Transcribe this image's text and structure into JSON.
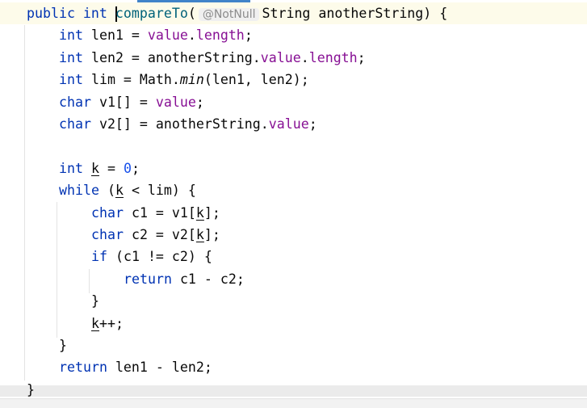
{
  "editor": {
    "language": "java",
    "colors": {
      "keyword": "#0033b3",
      "field": "#871094",
      "number": "#1750eb",
      "method": "#00627a",
      "text": "#080808",
      "accent": "#4083c9"
    },
    "lines": [
      {
        "indent": 0,
        "tokens": [
          {
            "t": "public int ",
            "c": "kw"
          },
          {
            "caret": true
          },
          {
            "t": "compareTo",
            "c": "mth"
          },
          {
            "t": "("
          },
          {
            "t": "@NotNull",
            "c": "hint"
          },
          {
            "t": "String anotherString) {"
          }
        ]
      },
      {
        "indent": 1,
        "tokens": [
          {
            "t": "int ",
            "c": "kw"
          },
          {
            "t": "len1 = "
          },
          {
            "t": "value",
            "c": "fld"
          },
          {
            "t": "."
          },
          {
            "t": "length",
            "c": "fld"
          },
          {
            "t": ";"
          }
        ]
      },
      {
        "indent": 1,
        "tokens": [
          {
            "t": "int ",
            "c": "kw"
          },
          {
            "t": "len2 = anotherString."
          },
          {
            "t": "value",
            "c": "fld"
          },
          {
            "t": "."
          },
          {
            "t": "length",
            "c": "fld"
          },
          {
            "t": ";"
          }
        ]
      },
      {
        "indent": 1,
        "tokens": [
          {
            "t": "int ",
            "c": "kw"
          },
          {
            "t": "lim = Math."
          },
          {
            "t": "min",
            "c": "it"
          },
          {
            "t": "(len1, len2);"
          }
        ]
      },
      {
        "indent": 1,
        "tokens": [
          {
            "t": "char ",
            "c": "kw"
          },
          {
            "t": "v1[] = "
          },
          {
            "t": "value",
            "c": "fld"
          },
          {
            "t": ";"
          }
        ]
      },
      {
        "indent": 1,
        "tokens": [
          {
            "t": "char ",
            "c": "kw"
          },
          {
            "t": "v2[] = anotherString."
          },
          {
            "t": "value",
            "c": "fld"
          },
          {
            "t": ";"
          }
        ]
      },
      {
        "indent": 0,
        "tokens": []
      },
      {
        "indent": 1,
        "tokens": [
          {
            "t": "int ",
            "c": "kw"
          },
          {
            "t": "k",
            "c": "ul"
          },
          {
            "t": " = "
          },
          {
            "t": "0",
            "c": "num"
          },
          {
            "t": ";"
          }
        ]
      },
      {
        "indent": 1,
        "tokens": [
          {
            "t": "while ",
            "c": "kw"
          },
          {
            "t": "("
          },
          {
            "t": "k",
            "c": "ul"
          },
          {
            "t": " < lim) {"
          }
        ]
      },
      {
        "indent": 2,
        "tokens": [
          {
            "t": "char ",
            "c": "kw"
          },
          {
            "t": "c1 = v1["
          },
          {
            "t": "k",
            "c": "ul"
          },
          {
            "t": "];"
          }
        ]
      },
      {
        "indent": 2,
        "tokens": [
          {
            "t": "char ",
            "c": "kw"
          },
          {
            "t": "c2 = v2["
          },
          {
            "t": "k",
            "c": "ul"
          },
          {
            "t": "];"
          }
        ]
      },
      {
        "indent": 2,
        "tokens": [
          {
            "t": "if ",
            "c": "kw"
          },
          {
            "t": "(c1 != c2) {"
          }
        ]
      },
      {
        "indent": 3,
        "tokens": [
          {
            "t": "return ",
            "c": "kw"
          },
          {
            "t": "c1 - c2;"
          }
        ]
      },
      {
        "indent": 2,
        "tokens": [
          {
            "t": "}"
          }
        ]
      },
      {
        "indent": 2,
        "tokens": [
          {
            "t": "k",
            "c": "ul"
          },
          {
            "t": "++;"
          }
        ]
      },
      {
        "indent": 1,
        "tokens": [
          {
            "t": "}"
          }
        ]
      },
      {
        "indent": 1,
        "tokens": [
          {
            "t": "return ",
            "c": "kw"
          },
          {
            "t": "len1 - len2;"
          }
        ]
      },
      {
        "indent": 0,
        "tokens": [
          {
            "t": "}"
          }
        ]
      }
    ]
  }
}
